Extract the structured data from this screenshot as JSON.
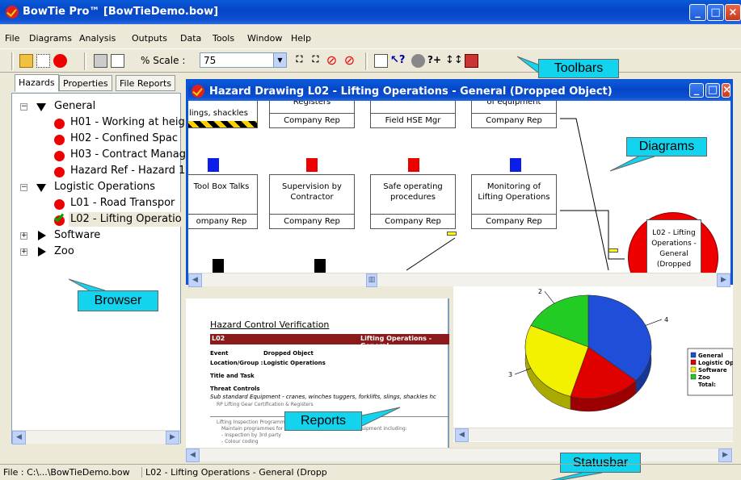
{
  "app": {
    "title": "BowTie Pro™ [BowTieDemo.bow]"
  },
  "menu": [
    "File",
    "Diagrams",
    "Analysis",
    "Outputs",
    "Data",
    "Tools",
    "Window",
    "Help"
  ],
  "toolbar": {
    "scale_label": "% Scale :",
    "scale_value": "75"
  },
  "browser": {
    "tabs": [
      "Hazards",
      "Properties",
      "File Reports"
    ],
    "tree": {
      "general": "General",
      "h01": "H01 - Working at heig",
      "h02": "H02 - Confined Spac",
      "h03": "H03 - Contract Manag",
      "href": "Hazard Ref - Hazard 1",
      "logistic": "Logistic Operations",
      "l01": "L01 - Road Transpor",
      "l02": "L02 - Lifting Operatio",
      "software": "Software",
      "zoo": "Zoo"
    }
  },
  "hazard_window": {
    "title": "Hazard Drawing L02 - Lifting Operations - General (Dropped Object)",
    "top_boxes": [
      {
        "label": "lings, shackles",
        "rep": ""
      },
      {
        "label": "Registers",
        "rep": "Company Rep"
      },
      {
        "label": "",
        "rep": "Field HSE Mgr"
      },
      {
        "label": "of equipment",
        "rep": "Company Rep"
      }
    ],
    "mid_boxes": [
      {
        "label": "Tool Box Talks",
        "rep": "ompany Rep"
      },
      {
        "label": "Supervision by Contractor",
        "rep": "Company Rep"
      },
      {
        "label": "Safe operating procedures",
        "rep": "Company Rep"
      },
      {
        "label": "Monitoring of Lifting Operations",
        "rep": "Company Rep"
      }
    ],
    "hazard_circle": "L02 - Lifting Operations - General (Dropped"
  },
  "report": {
    "heading": "Hazard Control Verification",
    "band_left": "L02",
    "band_right": "Lifting Operations - General",
    "event_label": "Event",
    "event_value": "Dropped Object",
    "location_label": "Location/Group :",
    "location_value": "Logistic Operations",
    "title_task": "Title and Task",
    "threat_controls": "Threat Controls",
    "threat_line": "Sub standard Equipment - cranes, winches tuggers, forklifts, slings, shackles hc",
    "rp_line": "RP Lifting Gear Certification & Registers",
    "sub1": "Lifting Inspection Programme",
    "sub2": "Maintain programmes for",
    "sub2b": "equipment including:",
    "sub3": "- Inspection by 3rd party",
    "sub4": "- Colour coding"
  },
  "chart_data": {
    "type": "pie",
    "categories": [
      "General",
      "Logistic Op",
      "Software",
      "Zoo"
    ],
    "values": [
      4,
      2,
      3,
      2
    ],
    "data_labels": [
      "4",
      "",
      "3",
      "2"
    ],
    "legend": [
      "General",
      "Logistic Op",
      "Software",
      "Zoo",
      "Total:"
    ],
    "colors": [
      "#1f4ed8",
      "#e00000",
      "#f2f200",
      "#22cc22"
    ]
  },
  "callouts": {
    "toolbars": "Toolbars",
    "diagrams": "Diagrams",
    "browser": "Browser",
    "reports": "Reports",
    "statusbar": "Statusbar"
  },
  "status": {
    "file": "File : C:\\...\\BowTieDemo.bow",
    "hazard": "L02 - Lifting Operations - General (Dropp"
  }
}
